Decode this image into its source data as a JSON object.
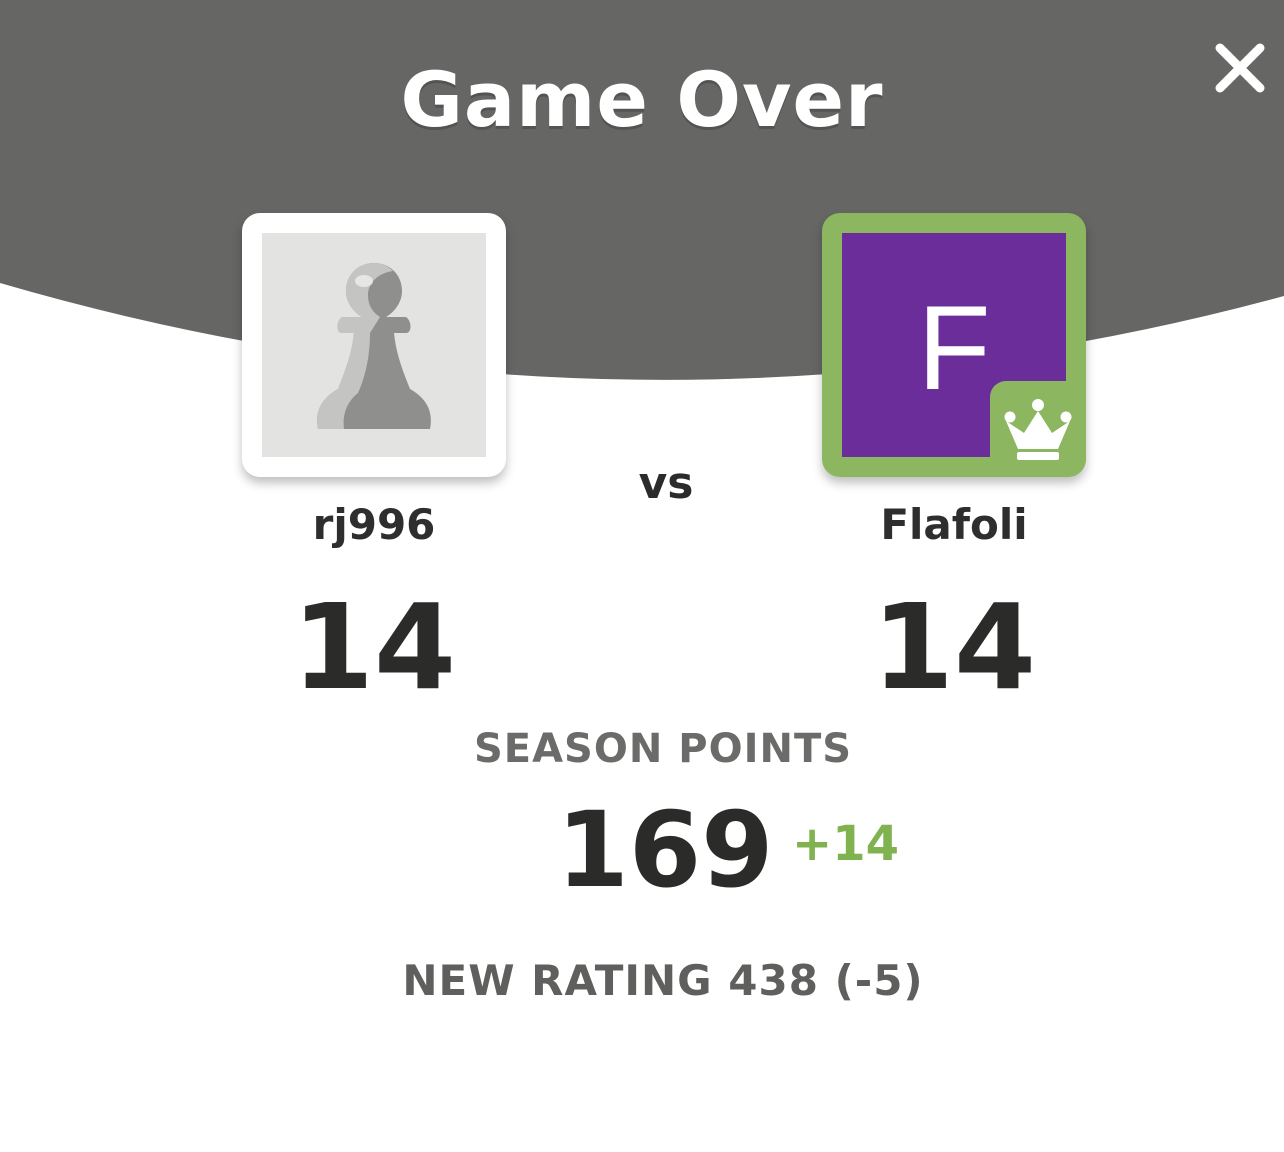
{
  "modal": {
    "title": "Game Over",
    "close_icon": "close-icon",
    "header_color": "#666665"
  },
  "players": {
    "left": {
      "name": "rj996",
      "score": "14",
      "avatar_icon": "pawn-icon"
    },
    "vs_label": "vs",
    "right": {
      "name": "Flafoli",
      "score": "14",
      "avatar_letter": "F",
      "avatar_color": "#6a2d9a",
      "frame_color": "#8db661",
      "badge_icon": "crown-icon"
    }
  },
  "season": {
    "label": "SEASON POINTS",
    "value": "169",
    "delta": "+14",
    "delta_color": "#80b34f"
  },
  "rating": {
    "text": "NEW RATING 438 (-5)"
  }
}
